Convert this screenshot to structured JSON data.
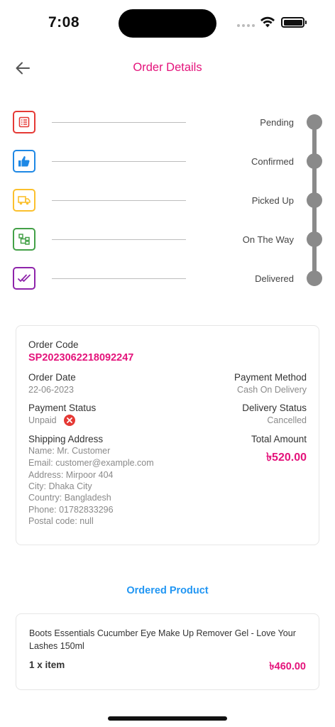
{
  "status_bar": {
    "time": "7:08"
  },
  "header": {
    "title": "Order Details"
  },
  "timeline": [
    {
      "label": "Pending",
      "color": "#e53935",
      "icon": "list-icon"
    },
    {
      "label": "Confirmed",
      "color": "#1e88e5",
      "icon": "thumbs-up-icon"
    },
    {
      "label": "Picked Up",
      "color": "#fbc02d",
      "icon": "truck-icon"
    },
    {
      "label": "On The Way",
      "color": "#43a047",
      "icon": "route-icon"
    },
    {
      "label": "Delivered",
      "color": "#8e24aa",
      "icon": "double-check-icon"
    }
  ],
  "order": {
    "code_label": "Order Code",
    "code": "SP2023062218092247",
    "date_label": "Order Date",
    "date": "22-06-2023",
    "payment_method_label": "Payment Method",
    "payment_method": "Cash On Delivery",
    "payment_status_label": "Payment Status",
    "payment_status": "Unpaid",
    "delivery_status_label": "Delivery Status",
    "delivery_status": "Cancelled",
    "shipping_label": "Shipping Address",
    "shipping": {
      "name": "Name: Mr. Customer",
      "email": "Email: customer@example.com",
      "address": "Address: Mirpoor 404",
      "city": "City: Dhaka City",
      "country": "Country: Bangladesh",
      "phone": "Phone: 01782833296",
      "postal": "Postal code: null"
    },
    "total_label": "Total Amount",
    "total": "৳520.00"
  },
  "products_section": {
    "title": "Ordered Product"
  },
  "product": {
    "name": "Boots Essentials Cucumber Eye Make Up Remover Gel - Love Your Lashes 150ml",
    "qty": "1 x item",
    "price": "৳460.00"
  },
  "colors": {
    "accent": "#e4137b",
    "link": "#2196f3",
    "timeline_rail": "#8a8a8a"
  }
}
